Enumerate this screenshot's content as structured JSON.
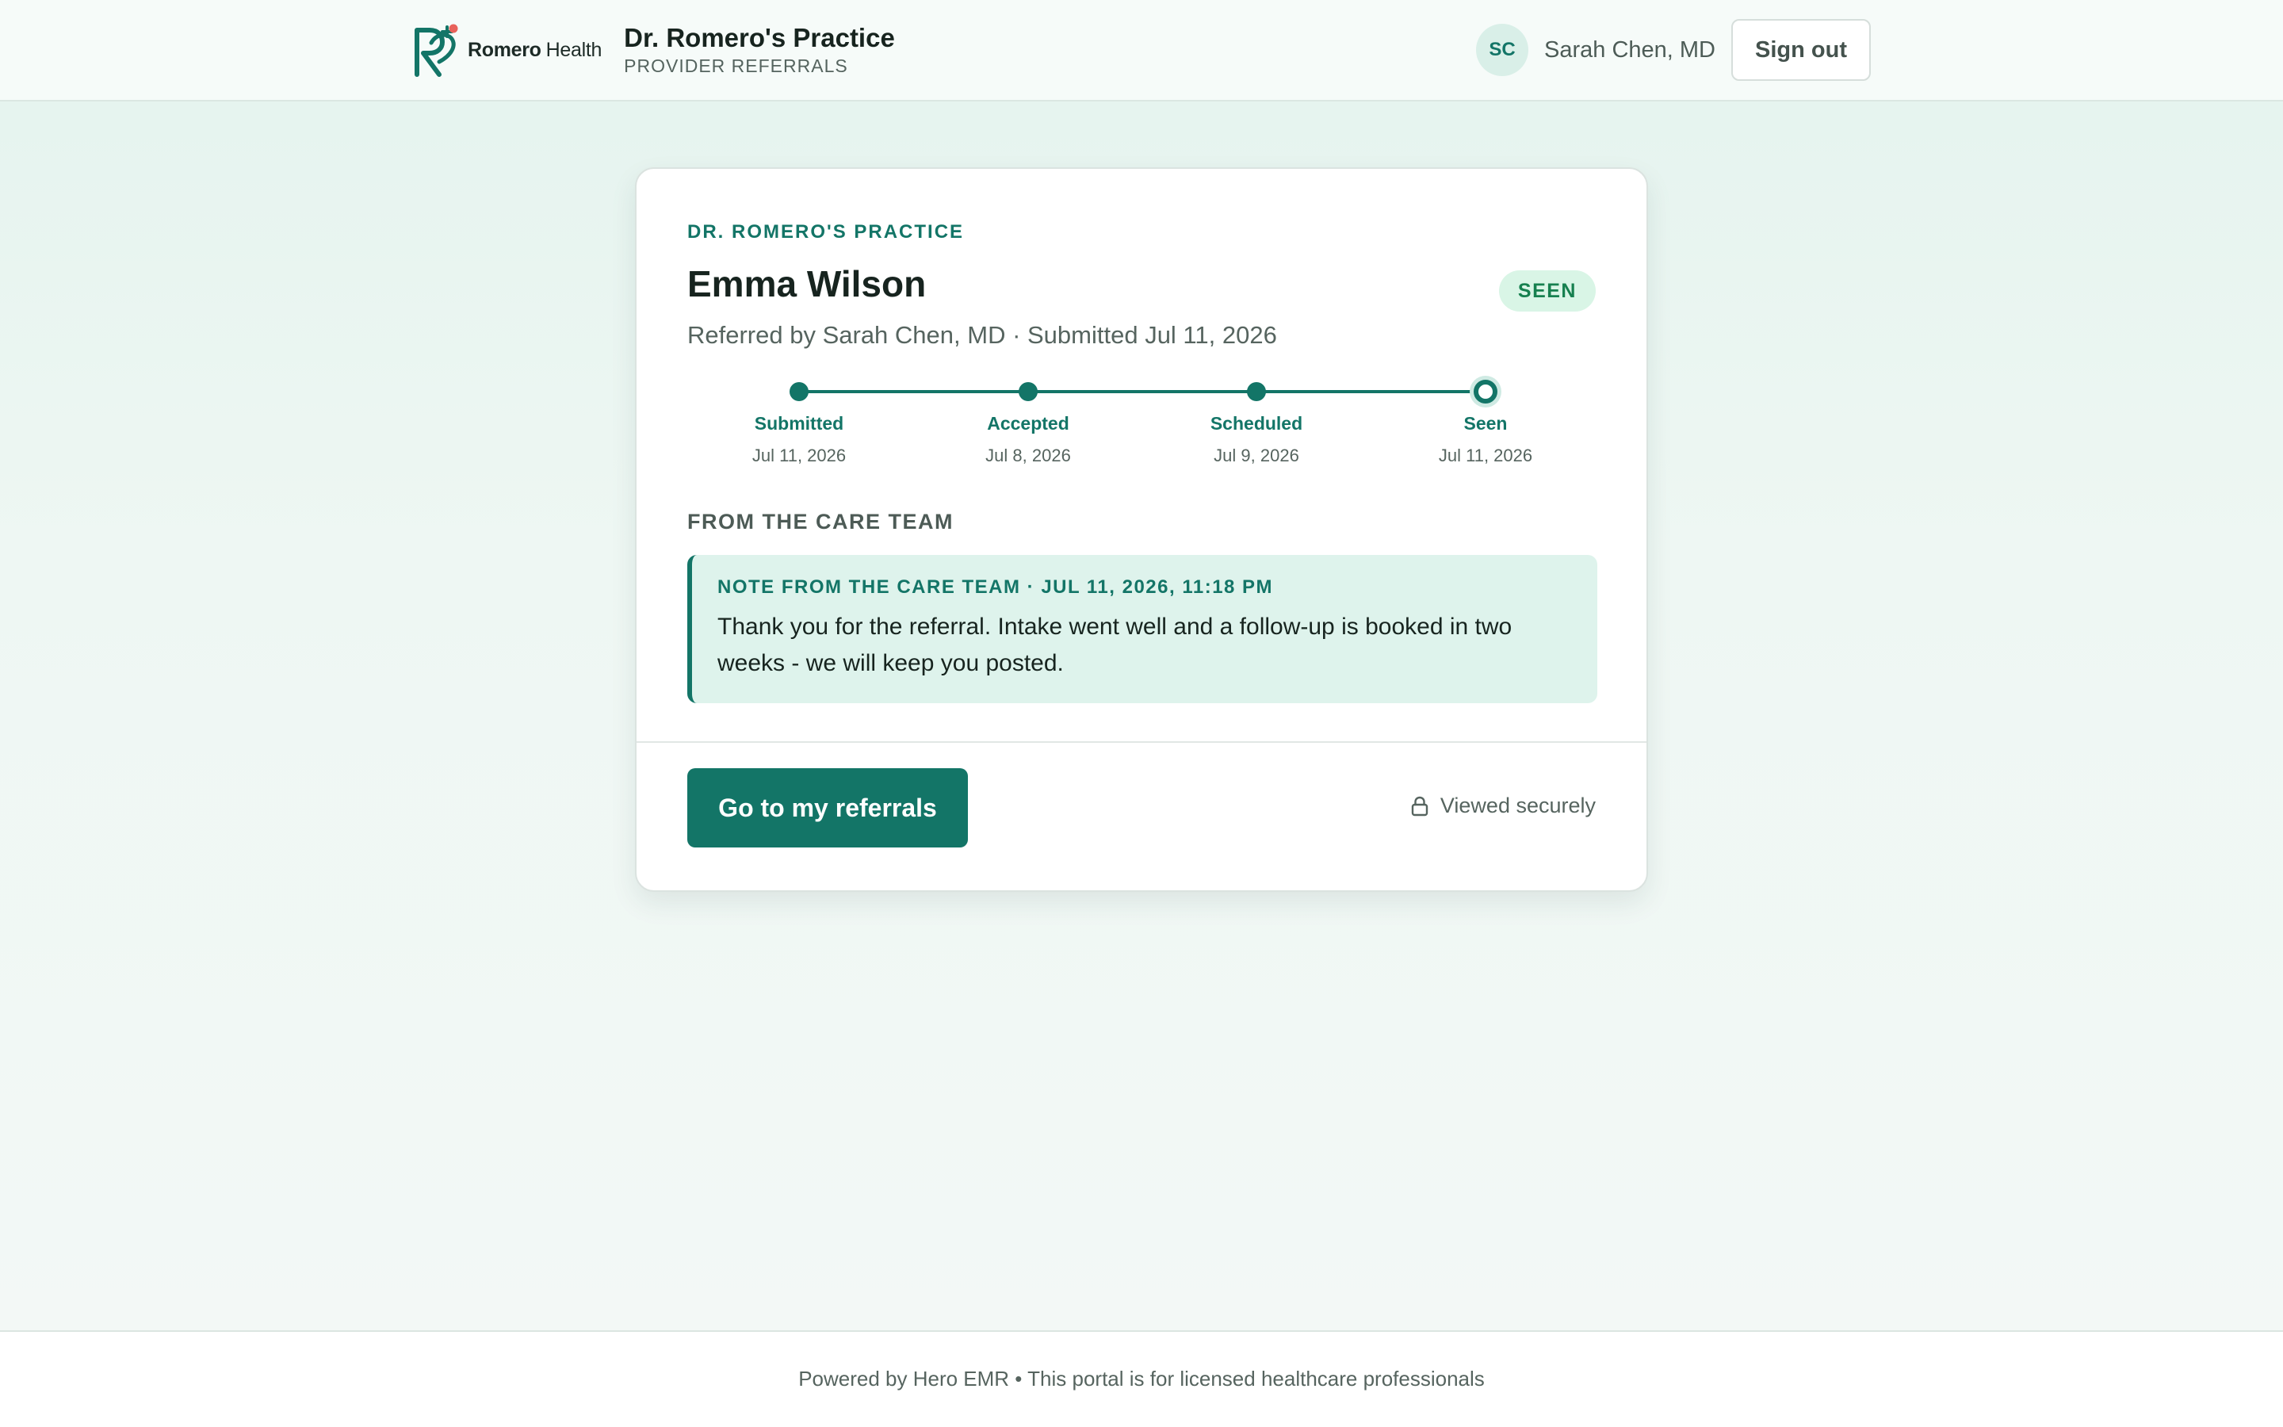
{
  "header": {
    "logo": {
      "icon": "romero-health-logo-icon",
      "text_bold": "Romero",
      "text_light": "Health"
    },
    "practice_name": "Dr. Romero's Practice",
    "practice_subtitle": "PROVIDER REFERRALS",
    "user": {
      "initials": "SC",
      "name": "Sarah Chen, MD"
    },
    "sign_out_label": "Sign out"
  },
  "referral": {
    "eyebrow": "DR. ROMERO'S PRACTICE",
    "patient_name": "Emma Wilson",
    "status": "SEEN",
    "meta": "Referred by Sarah Chen, MD · Submitted Jul 11, 2026",
    "timeline": [
      {
        "label": "Submitted",
        "date": "Jul 11, 2026"
      },
      {
        "label": "Accepted",
        "date": "Jul 8, 2026"
      },
      {
        "label": "Scheduled",
        "date": "Jul 9, 2026"
      },
      {
        "label": "Seen",
        "date": "Jul 11, 2026"
      }
    ],
    "current_step": "Seen",
    "section_heading": "FROM THE CARE TEAM",
    "note": {
      "header": "NOTE FROM THE CARE TEAM · JUL 11, 2026, 11:18 PM",
      "text": "Thank you for the referral. Intake went well and a follow-up is booked in two weeks - we will keep you posted."
    },
    "primary_button_label": "Go to my referrals",
    "secure_label": "Viewed securely",
    "secure_icon": "lock-icon"
  },
  "footer": {
    "text": "Powered by Hero EMR • This portal is for licensed healthcare professionals"
  },
  "colors": {
    "brand": "#137567",
    "brand_accent": "#e8625b",
    "status_seen_bg": "#d9f5e6",
    "status_seen_text": "#16804f",
    "note_bg": "#def3ec"
  }
}
